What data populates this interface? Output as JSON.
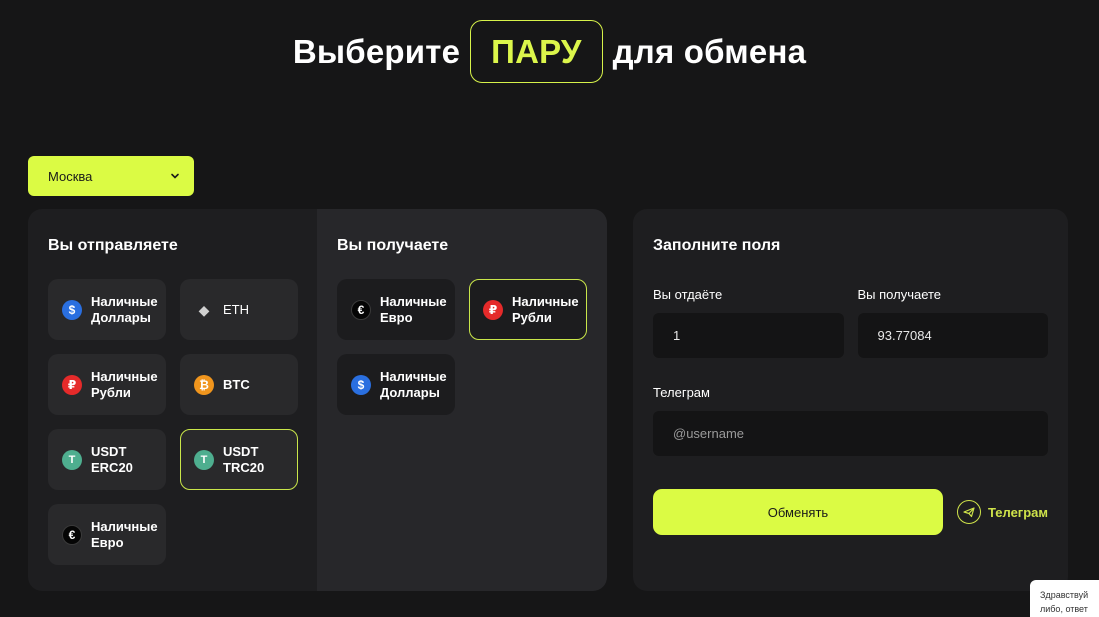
{
  "hero": {
    "prefix": "Выберите",
    "highlight": "ПАРУ",
    "suffix": "для обмена"
  },
  "city": {
    "value": "Москва"
  },
  "send": {
    "title": "Вы отправляете",
    "items": [
      {
        "label1": "Наличные",
        "label2": "Доллары",
        "icon": "$"
      },
      {
        "label1": "ETH",
        "label2": "",
        "icon": "◆"
      },
      {
        "label1": "Наличные",
        "label2": "Рубли",
        "icon": "₽"
      },
      {
        "label1": "BTC",
        "label2": "",
        "icon": "₿"
      },
      {
        "label1": "USDT",
        "label2": "ERC20",
        "icon": "T"
      },
      {
        "label1": "USDT",
        "label2": "TRC20",
        "icon": "T"
      },
      {
        "label1": "Наличные",
        "label2": "Евро",
        "icon": "€"
      }
    ]
  },
  "receive": {
    "title": "Вы получаете",
    "items": [
      {
        "label1": "Наличные",
        "label2": "Евро",
        "icon": "€"
      },
      {
        "label1": "Наличные",
        "label2": "Рубли",
        "icon": "₽"
      },
      {
        "label1": "Наличные",
        "label2": "Доллары",
        "icon": "$"
      }
    ]
  },
  "form": {
    "title": "Заполните поля",
    "give_label": "Вы отдаёте",
    "give_value": "1",
    "get_label": "Вы получаете",
    "get_value": "93.77084",
    "telegram_label": "Телеграм",
    "telegram_placeholder": "@username",
    "submit_label": "Обменять",
    "telegram_link": "Телеграм"
  },
  "chat": {
    "line1": "Здравствуй",
    "line2": "либо, ответ"
  },
  "colors": {
    "accent": "#dbfb44",
    "background": "#161617",
    "panel": "#1e1e20"
  }
}
